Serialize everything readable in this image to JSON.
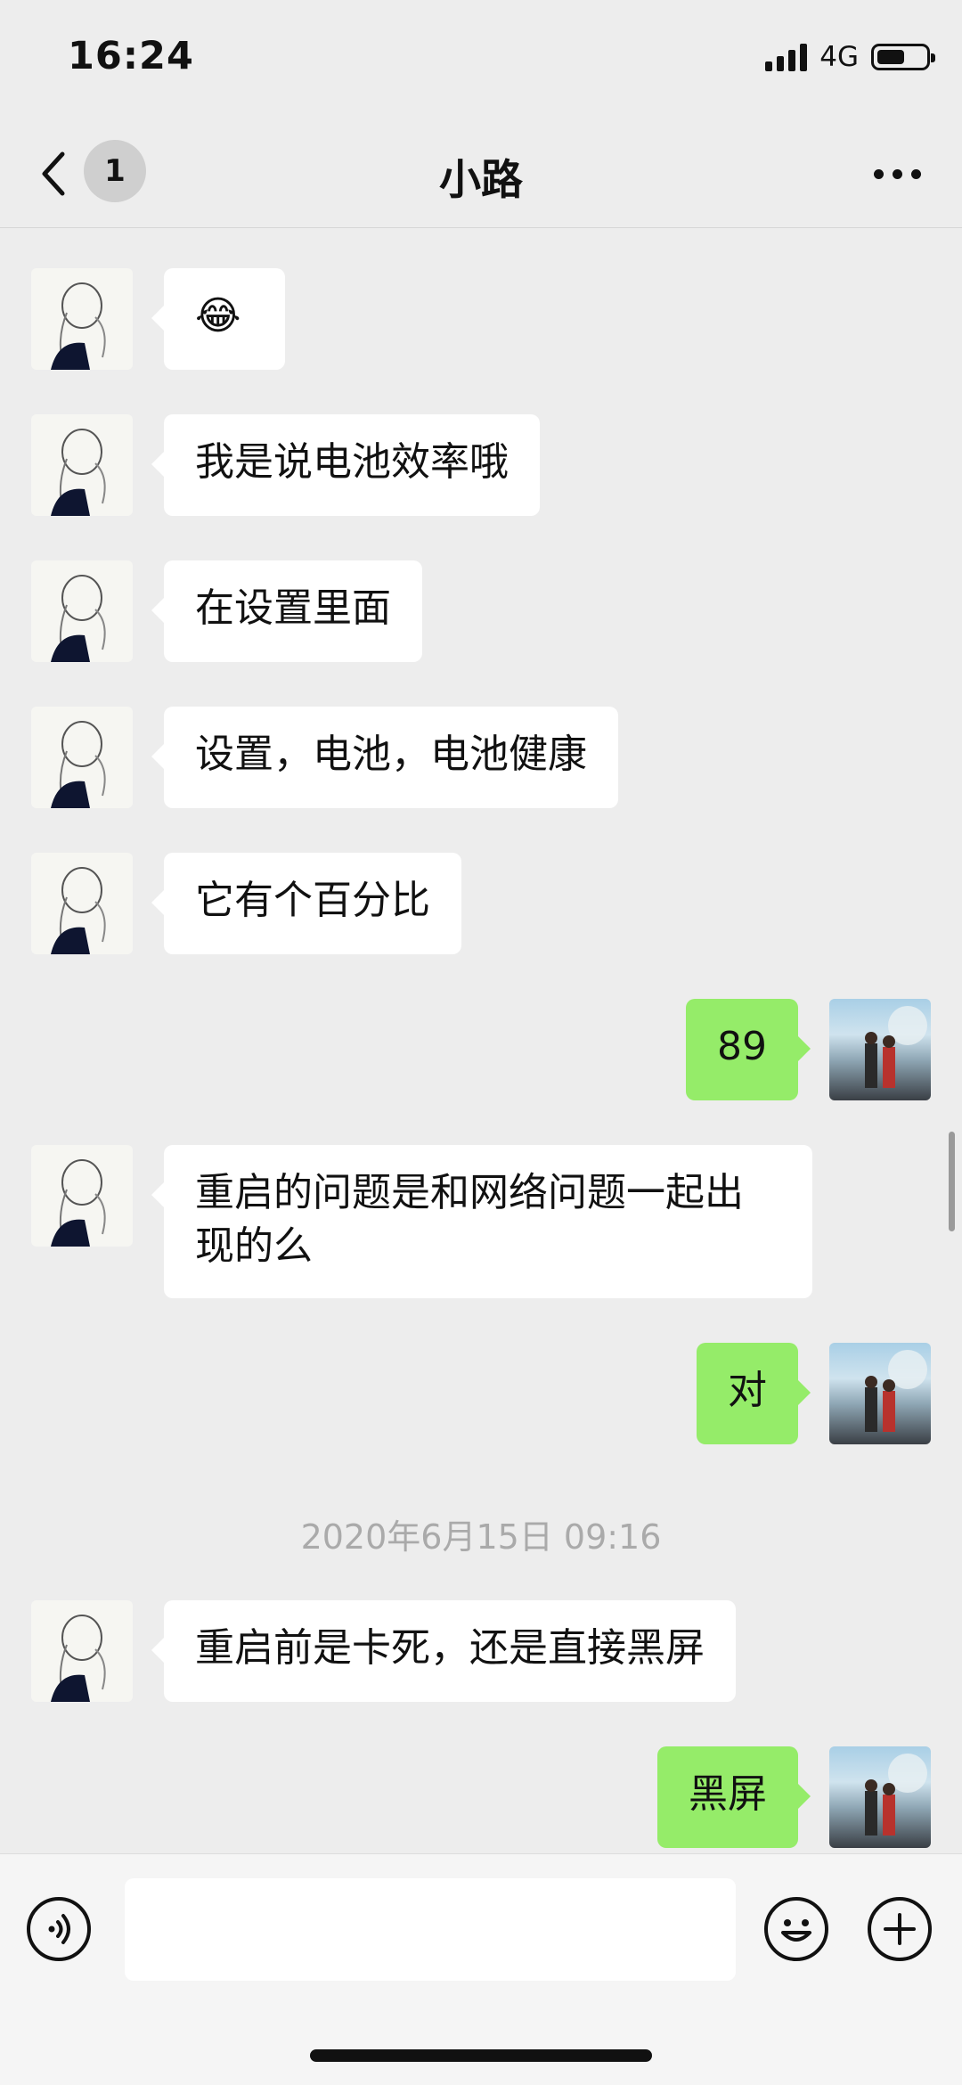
{
  "status": {
    "time": "16:24",
    "network": "4G",
    "battery_level": 0.62
  },
  "nav": {
    "badge": "1",
    "title": "小路"
  },
  "messages": [
    {
      "side": "in",
      "text": "😂"
    },
    {
      "side": "in",
      "text": "我是说电池效率哦"
    },
    {
      "side": "in",
      "text": "在设置里面"
    },
    {
      "side": "in",
      "text": "设置，电池，电池健康"
    },
    {
      "side": "in",
      "text": "它有个百分比"
    },
    {
      "side": "out",
      "text": "89"
    },
    {
      "side": "in",
      "text": "重启的问题是和网络问题一起出现的么"
    },
    {
      "side": "out",
      "text": "对"
    },
    {
      "side": "in",
      "text": "重启前是卡死，还是直接黑屏"
    },
    {
      "side": "out",
      "text": "黑屏"
    }
  ],
  "timestamp": "2020年6月15日 09:16",
  "icons": {
    "back": "chevron-left-icon",
    "more": "more-horizontal-icon",
    "voice": "voice-input-icon",
    "emoji": "emoji-icon",
    "plus": "plus-icon"
  },
  "colors": {
    "outgoing_bubble": "#95ec69",
    "incoming_bubble": "#ffffff",
    "background": "#ededed"
  }
}
